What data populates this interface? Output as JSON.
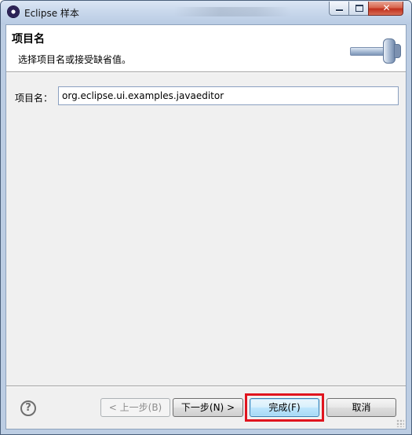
{
  "window": {
    "title": "Eclipse 样本",
    "close_glyph": "✕",
    "icon": "eclipse-icon"
  },
  "header": {
    "title": "项目名",
    "description": "选择项目名或接受缺省值。",
    "banner_icon": "wizard-banner-icon"
  },
  "form": {
    "project_label": "项目名：",
    "project_value": "org.eclipse.ui.examples.javaeditor"
  },
  "footer": {
    "help_glyph": "?",
    "back_label": "< 上一步(B)",
    "next_label": "下一步(N) >",
    "finish_label": "完成(F)",
    "cancel_label": "取消"
  },
  "colors": {
    "highlight": "#e0141e",
    "accent": "#3c7fb1"
  }
}
